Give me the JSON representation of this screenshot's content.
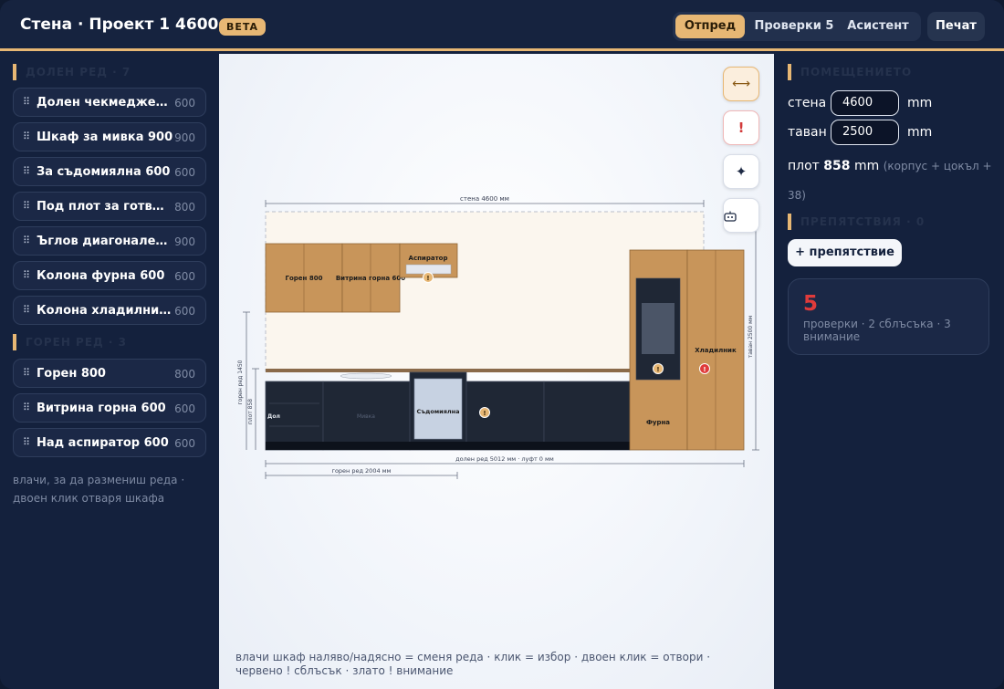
{
  "header": {
    "title": "Стена · Проект 1 4600",
    "badge": "BETA",
    "tabs": [
      {
        "label": "Отпред"
      },
      {
        "label": "Проверки 5"
      },
      {
        "label": "Асистент"
      }
    ],
    "print_label": "Печат"
  },
  "left": {
    "lower_title": "ДОЛЕН РЕД · 7",
    "lower_items": [
      {
        "name": "Долен чекмеджет…",
        "width": "600"
      },
      {
        "name": "Шкаф за мивка 900",
        "width": "900"
      },
      {
        "name": "За съдомиялна 600",
        "width": "600"
      },
      {
        "name": "Под плот за готв…",
        "width": "800"
      },
      {
        "name": "Ъглов диагонален …",
        "width": "900"
      },
      {
        "name": "Колона фурна 600",
        "width": "600"
      },
      {
        "name": "Колона хладилник …",
        "width": "600"
      }
    ],
    "upper_title": "ГОРЕН РЕД · 3",
    "upper_items": [
      {
        "name": "Горен 800",
        "width": "800"
      },
      {
        "name": "Витрина горна 600",
        "width": "600"
      },
      {
        "name": "Над аспиратор 600",
        "width": "600"
      }
    ],
    "hint": "влачи, за да размениш реда · двоен клик отваря шкафа"
  },
  "canvas": {
    "dim_wall": "стена 4600 мм",
    "dim_lower": "долен ред 5012 мм · луфт 0 мм",
    "dim_upper": "горен ред 2004 мм",
    "dim_ceiling": "таван 2500 мм",
    "dim_upper_height": "горен ред 1450",
    "dim_plot_height": "плот 858",
    "cab_labels": {
      "upper_800": "Горен 800",
      "vitrina": "Витрина горна 600",
      "hood": "Аспиратор",
      "dishwasher": "Съдомиялна",
      "drawer": "Дол",
      "sink": "Мивка",
      "oven": "Фурна",
      "fridge": "Хладилник"
    },
    "warn_mark": "!",
    "error_mark": "!",
    "tools": {
      "dimensions_icon": "⟷",
      "checks_icon": "!",
      "assistant_icon": "✦",
      "robot_icon": "robot-icon"
    },
    "footer": "влачи шкаф наляво/надясно = сменя реда · клик = избор · двоен клик = отвори · червено ! сблъсък · злато ! внимание"
  },
  "right": {
    "room_title": "ПОМЕЩЕНИЕТО",
    "wall_label": "стена",
    "wall_value": "4600",
    "ceiling_label": "таван",
    "ceiling_value": "2500",
    "unit": "mm",
    "plot_prefix": "плот",
    "plot_value": "858",
    "plot_unit": "mm",
    "plot_note": "(корпус + цокъл + 38)",
    "obstacles_title": "ПРЕПЯТСТВИЯ · 0",
    "add_obstacle_label": "+ препятствие",
    "checks_count": "5",
    "checks_text": "проверки · 2 сблъсъка · 3 внимание"
  },
  "colors": {
    "accent": "#e7b774",
    "panel": "#14213d",
    "wood": "#c8955a",
    "dark_cabinet": "#1f2735",
    "error": "#e03b3b"
  }
}
